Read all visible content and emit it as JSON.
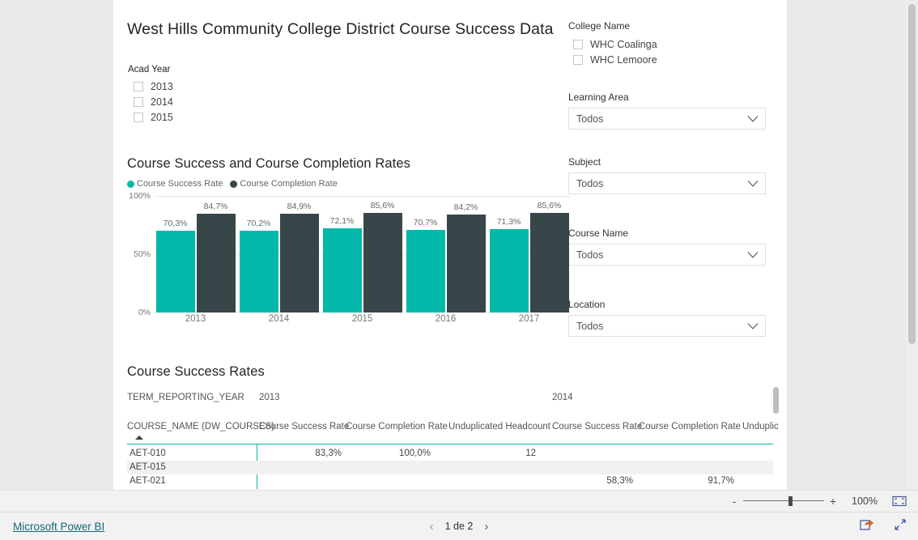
{
  "report": {
    "title": "West Hills Community College District Course Success Data"
  },
  "acad_year_slicer": {
    "header": "Acad Year",
    "items": [
      {
        "label": "2013",
        "checked": false
      },
      {
        "label": "2014",
        "checked": false
      },
      {
        "label": "2015",
        "checked": false
      }
    ]
  },
  "filters": {
    "college_name": {
      "label": "College Name",
      "items": [
        {
          "label": "WHC Coalinga",
          "checked": false
        },
        {
          "label": "WHC Lemoore",
          "checked": false
        }
      ]
    },
    "learning_area": {
      "label": "Learning Area",
      "value": "Todos"
    },
    "subject": {
      "label": "Subject",
      "value": "Todos"
    },
    "course_name": {
      "label": "Course Name",
      "value": "Todos"
    },
    "location": {
      "label": "Location",
      "value": "Todos"
    }
  },
  "chart_data": {
    "type": "bar",
    "title": "Course Success and Course Completion Rates",
    "xlabel": "",
    "ylabel": "",
    "ylim": [
      0,
      100
    ],
    "ytick_labels": [
      "100%",
      "50%",
      "0%"
    ],
    "ytick_values": [
      100,
      50,
      0
    ],
    "grid": true,
    "legend_position": "top-left",
    "categories": [
      "2013",
      "2014",
      "2015",
      "2016",
      "2017"
    ],
    "series": [
      {
        "name": "Course Success Rate",
        "color": "#01b8aa",
        "values": [
          70.3,
          70.2,
          72.1,
          70.7,
          71.3
        ],
        "labels": [
          "70,3%",
          "70,2%",
          "72,1%",
          "70,7%",
          "71,3%"
        ]
      },
      {
        "name": "Course Completion Rate",
        "color": "#374649",
        "values": [
          84.7,
          84.9,
          85.6,
          84.2,
          85.6
        ],
        "labels": [
          "84,7%",
          "84,9%",
          "85,6%",
          "84,2%",
          "85,6%"
        ]
      }
    ]
  },
  "matrix": {
    "title": "Course Success Rates",
    "row_header_top": "TERM_REPORTING_YEAR",
    "row_header_bottom": "COURSE_NAME (DW_COURSES)",
    "year_groups": [
      {
        "label": "2013"
      },
      {
        "label": "2014"
      }
    ],
    "measure_headers": [
      "Course Success Rate",
      "Course Completion Rate",
      "Unduplicated Headcount",
      "Course Success Rate",
      "Course Completion Rate",
      "Unduplic"
    ],
    "rows": [
      {
        "name": "AET-010",
        "cells": [
          "83,3%",
          "100,0%",
          "12",
          "",
          "",
          ""
        ]
      },
      {
        "name": "AET-015",
        "cells": [
          "",
          "",
          "",
          "",
          "",
          ""
        ]
      },
      {
        "name": "AET-021",
        "cells": [
          "",
          "",
          "",
          "58,3%",
          "91,7%",
          ""
        ]
      }
    ]
  },
  "zoom_toolbar": {
    "minus": "-",
    "plus": "+",
    "percent": "100%"
  },
  "footer": {
    "brand": "Microsoft Power BI",
    "page_indicator": "1 de 2",
    "prev": "‹",
    "next": "›"
  },
  "colors": {
    "accent_teal": "#01b8aa",
    "dark_slate": "#374649",
    "brand_link": "#14697a"
  }
}
